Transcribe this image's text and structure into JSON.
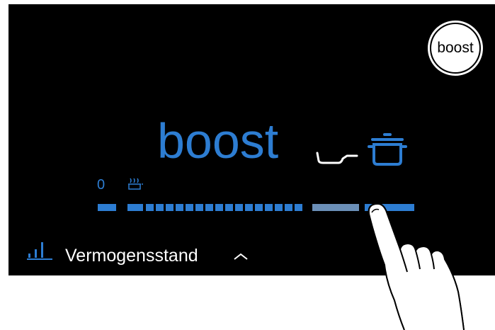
{
  "boost_button": {
    "label": "boost"
  },
  "display": {
    "mode_label": "boost"
  },
  "slider": {
    "min_label": "0",
    "active_level": "boost"
  },
  "bottom_bar": {
    "power_management_label": "Vermogensstand"
  },
  "colors": {
    "accent_blue": "#2d7dd2",
    "background": "#000000",
    "text_white": "#ffffff",
    "secondary_segment": "#6b8fb7"
  },
  "icons": {
    "pan": "frying-pan-icon",
    "pot": "pot-icon",
    "keep_warm": "keep-warm-icon",
    "level": "power-level-icon",
    "chevron": "chevron-up-icon",
    "hand": "pointing-hand-icon"
  }
}
